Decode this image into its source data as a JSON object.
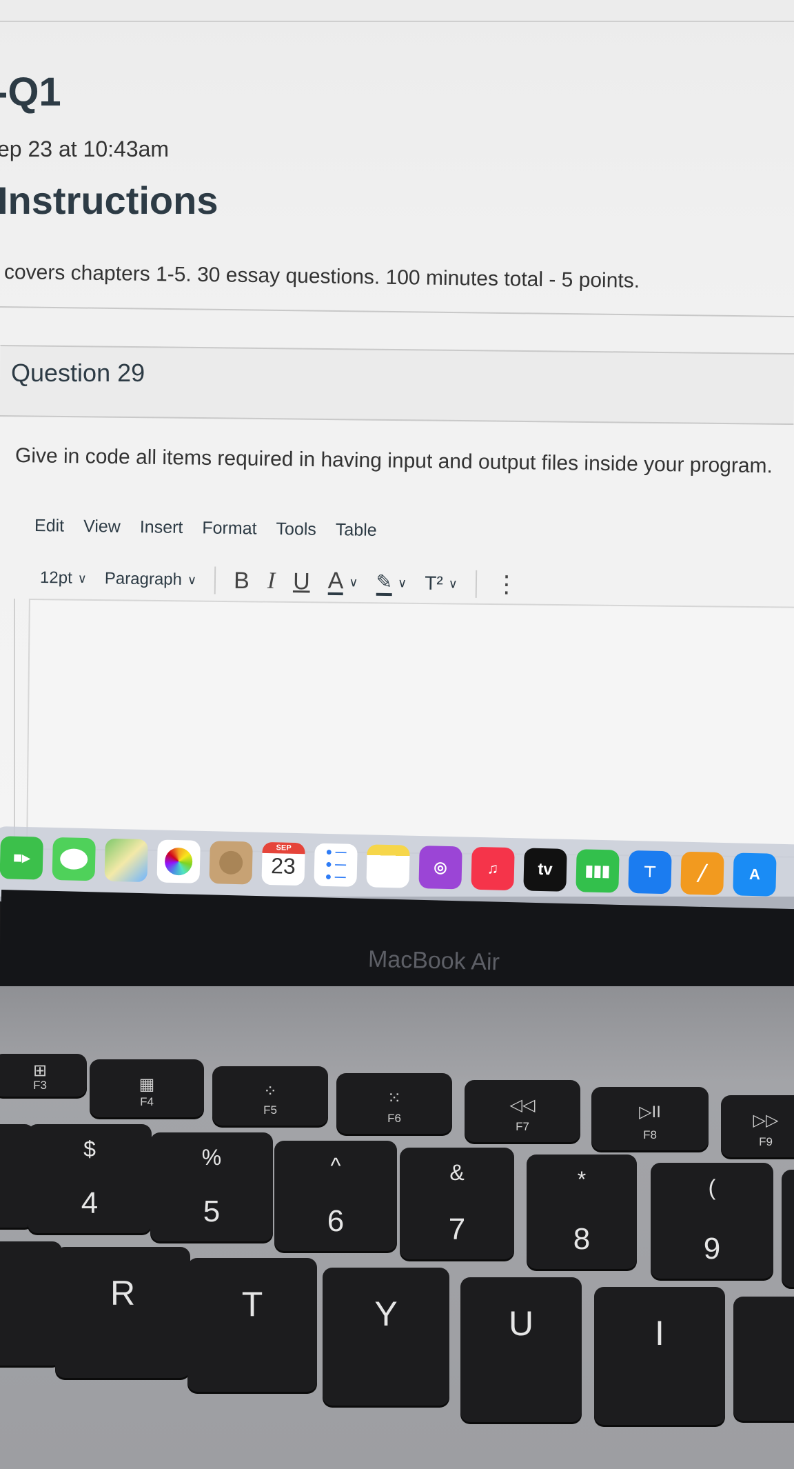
{
  "quiz": {
    "title": "-Q1",
    "date": "ep 23 at 10:43am",
    "instructions_heading": "Instructions",
    "instructions_text": "covers chapters 1-5. 30 essay questions.  100 minutes total - 5 points."
  },
  "question": {
    "title": "Question 29",
    "text": "Give in code all items required in having input and output files inside your program."
  },
  "editor": {
    "menu": [
      "Edit",
      "View",
      "Insert",
      "Format",
      "Tools",
      "Table"
    ],
    "font_size": "12pt",
    "block_format": "Paragraph",
    "bold": "B",
    "italic": "I",
    "underline": "U",
    "text_color": "A",
    "superscript": "T²",
    "more": "⋮"
  },
  "dock": {
    "calendar_month": "SEP",
    "calendar_day": "23",
    "tv_label": "tv",
    "apps": [
      "facetime-icon",
      "messages-icon",
      "maps-icon",
      "photos-icon",
      "contacts-icon",
      "calendar-icon",
      "reminders-icon",
      "notes-icon",
      "podcasts-icon",
      "music-icon",
      "tv-icon",
      "numbers-icon",
      "keynote-icon",
      "pages-icon",
      "app-store-icon"
    ]
  },
  "laptop_label": "MacBook Air",
  "keyboard": {
    "function_row": [
      {
        "icon": "⊞",
        "name": "F3"
      },
      {
        "icon": "▦",
        "name": "F4"
      },
      {
        "icon": "⁘",
        "name": "F5"
      },
      {
        "icon": "⁙",
        "name": "F6"
      },
      {
        "icon": "◁◁",
        "name": "F7"
      },
      {
        "icon": "▷II",
        "name": "F8"
      },
      {
        "icon": "▷▷",
        "name": "F9"
      }
    ],
    "number_row": [
      {
        "top": "$",
        "bottom": "4"
      },
      {
        "top": "%",
        "bottom": "5"
      },
      {
        "top": "^",
        "bottom": "6"
      },
      {
        "top": "&",
        "bottom": "7"
      },
      {
        "top": "*",
        "bottom": "8"
      },
      {
        "top": "(",
        "bottom": "9"
      }
    ],
    "letter_row": [
      "R",
      "T",
      "Y",
      "U",
      "I"
    ]
  }
}
